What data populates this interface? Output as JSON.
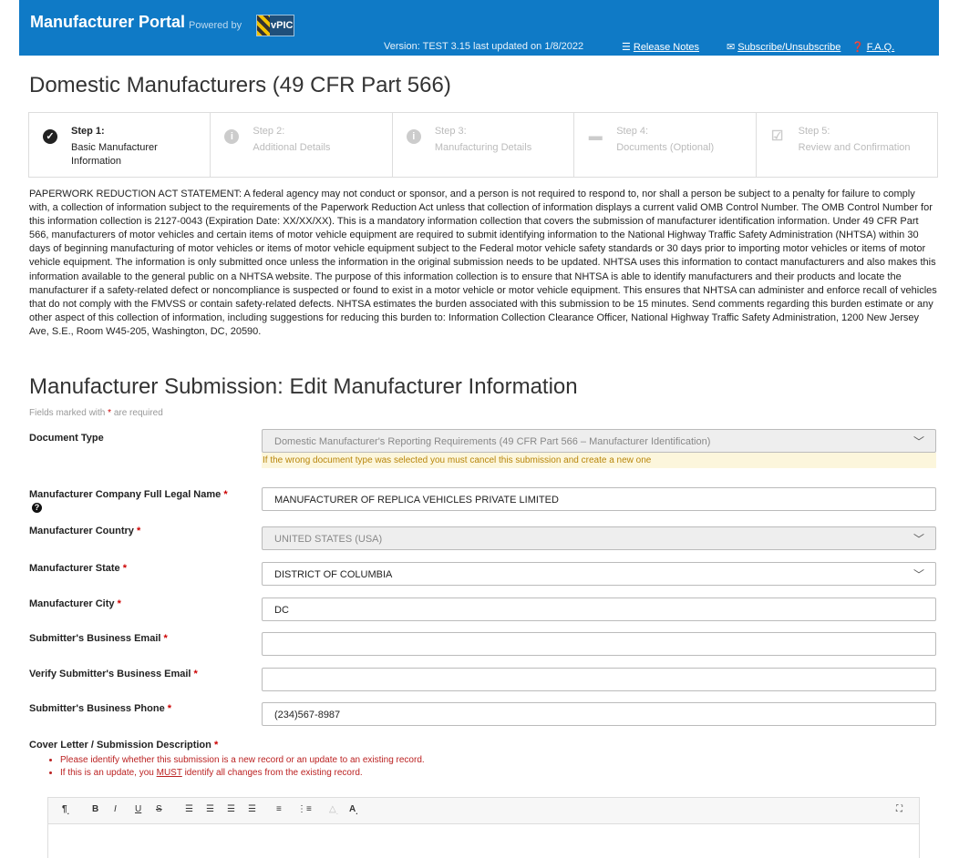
{
  "header": {
    "title": "Manufacturer Portal",
    "powered_by": "Powered by",
    "logo_text": "vPIC",
    "version": "Version: TEST 3.15 last updated on 1/8/2022",
    "links": {
      "release_notes": "Release Notes",
      "subscribe": "Subscribe/Unsubscribe",
      "faq": "F.A.Q."
    }
  },
  "page_title": "Domestic Manufacturers (49 CFR Part 566)",
  "steps": [
    {
      "title": "Step 1:",
      "desc": "Basic Manufacturer Information",
      "icon": "check-circle-icon",
      "active": true
    },
    {
      "title": "Step 2:",
      "desc": "Additional Details",
      "icon": "info-circle-icon",
      "active": false
    },
    {
      "title": "Step 3:",
      "desc": "Manufacturing Details",
      "icon": "info-circle-icon",
      "active": false
    },
    {
      "title": "Step 4:",
      "desc": "Documents (Optional)",
      "icon": "folder-open-icon",
      "active": false
    },
    {
      "title": "Step 5:",
      "desc": "Review and Confirmation",
      "icon": "check-square-icon",
      "active": false
    }
  ],
  "pra_statement": "PAPERWORK REDUCTION ACT STATEMENT: A federal agency may not conduct or sponsor, and a person is not required to respond to, nor shall a person be subject to a penalty for failure to comply with, a collection of information subject to the requirements of the Paperwork Reduction Act unless that collection of information displays a current valid OMB Control Number. The OMB Control Number for this information collection is 2127-0043 (Expiration Date: XX/XX/XX). This is a mandatory information collection that covers the submission of manufacturer identification information. Under 49 CFR Part 566, manufacturers of motor vehicles and certain items of motor vehicle equipment are required to submit identifying information to the National Highway Traffic Safety Administration (NHTSA) within 30 days of beginning manufacturing of motor vehicles or items of motor vehicle equipment subject to the Federal motor vehicle safety standards or 30 days prior to importing motor vehicles or items of motor vehicle equipment. The information is only submitted once unless the information in the original submission needs to be updated. NHTSA uses this information to contact manufacturers and also makes this information available to the general public on a NHTSA website. The purpose of this information collection is to ensure that NHTSA is able to identify manufacturers and their products and locate the manufacturer if a safety-related defect or noncompliance is suspected or found to exist in a motor vehicle or motor vehicle equipment. This ensures that NHTSA can administer and enforce recall of vehicles that do not comply with the FMVSS or contain safety-related defects. NHTSA estimates the burden associated with this submission to be 15 minutes. Send comments regarding this burden estimate or any other aspect of this collection of information, including suggestions for reducing this burden to: Information Collection Clearance Officer, National Highway Traffic Safety Administration, 1200 New Jersey Ave, S.E., Room W45-205, Washington, DC, 20590.",
  "form": {
    "title": "Manufacturer Submission: Edit Manufacturer Information",
    "required_note_pre": "Fields marked with",
    "required_note_star": "*",
    "required_note_post": "are required",
    "document_type": {
      "label": "Document Type",
      "value": "Domestic Manufacturer's Reporting Requirements (49 CFR Part 566 – Manufacturer Identification)",
      "warning": "If the wrong document type was selected you must cancel this submission and create a new one"
    },
    "company_name": {
      "label": "Manufacturer Company Full Legal Name",
      "value": "MANUFACTURER OF REPLICA VEHICLES PRIVATE LIMITED"
    },
    "country": {
      "label": "Manufacturer Country",
      "value": "UNITED STATES (USA)"
    },
    "state": {
      "label": "Manufacturer State",
      "value": "DISTRICT OF COLUMBIA"
    },
    "city": {
      "label": "Manufacturer City",
      "value": "DC"
    },
    "email": {
      "label": "Submitter's Business Email",
      "value": ""
    },
    "verify_email": {
      "label": "Verify Submitter's Business Email",
      "value": ""
    },
    "phone": {
      "label": "Submitter's Business Phone",
      "value": "(234)567-8987"
    },
    "cover_letter": {
      "label": "Cover Letter / Submission Description",
      "note1": "Please identify whether this submission is a new record or an update to an existing record.",
      "note2_pre": "If this is an update, you",
      "note2_em": "MUST",
      "note2_post": "identify all changes from the existing record."
    }
  },
  "editor_toolbar": {
    "paragraph": "¶",
    "bold": "B",
    "italic": "I",
    "underline": "U",
    "strike": "S",
    "font_color": "A"
  }
}
